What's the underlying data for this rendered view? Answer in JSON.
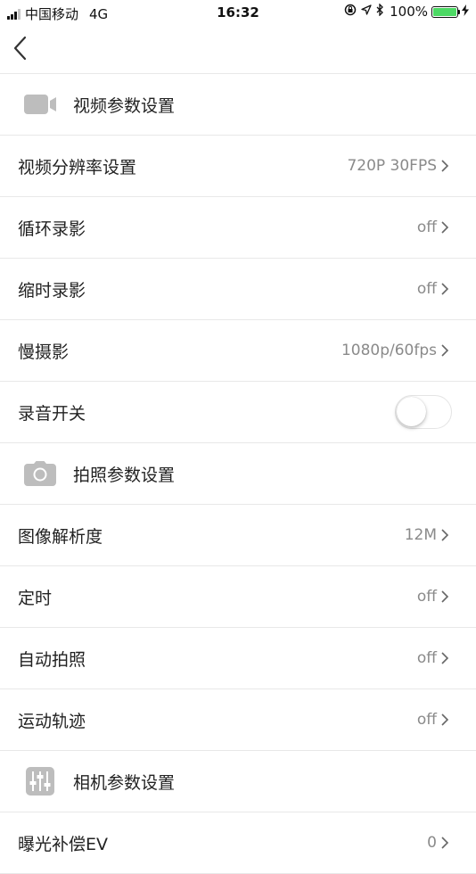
{
  "status_bar": {
    "carrier": "中国移动",
    "network": "4G",
    "time": "16:32",
    "battery": "100%",
    "battery_level": 1.0,
    "icons": [
      "signal-icon",
      "rotation-lock-icon",
      "location-arrow-icon",
      "bluetooth-icon",
      "battery-icon",
      "charging-bolt-icon"
    ]
  },
  "nav": {
    "back_icon": "chevron-left-icon"
  },
  "sections": {
    "video": {
      "title": "视频参数设置",
      "icon": "video-camera-icon",
      "rows": [
        {
          "label": "视频分辨率设置",
          "value": "720P 30FPS"
        },
        {
          "label": "循环录影",
          "value": "off"
        },
        {
          "label": "缩时录影",
          "value": "off"
        },
        {
          "label": "慢摄影",
          "value": "1080p/60fps"
        },
        {
          "label": "录音开关",
          "toggle": false
        }
      ]
    },
    "photo": {
      "title": "拍照参数设置",
      "icon": "camera-icon",
      "rows": [
        {
          "label": "图像解析度",
          "value": "12M"
        },
        {
          "label": "定时",
          "value": "off"
        },
        {
          "label": "自动拍照",
          "value": "off"
        },
        {
          "label": "运动轨迹",
          "value": "off"
        }
      ]
    },
    "camera": {
      "title": "相机参数设置",
      "icon": "sliders-icon",
      "rows": [
        {
          "label": "曝光补偿EV",
          "value": "0"
        }
      ]
    }
  },
  "colors": {
    "icon_gray": "#bdbdbd",
    "value_gray": "#8a8a8a",
    "divider": "#e8e8e8",
    "battery_green": "#4cd964"
  }
}
